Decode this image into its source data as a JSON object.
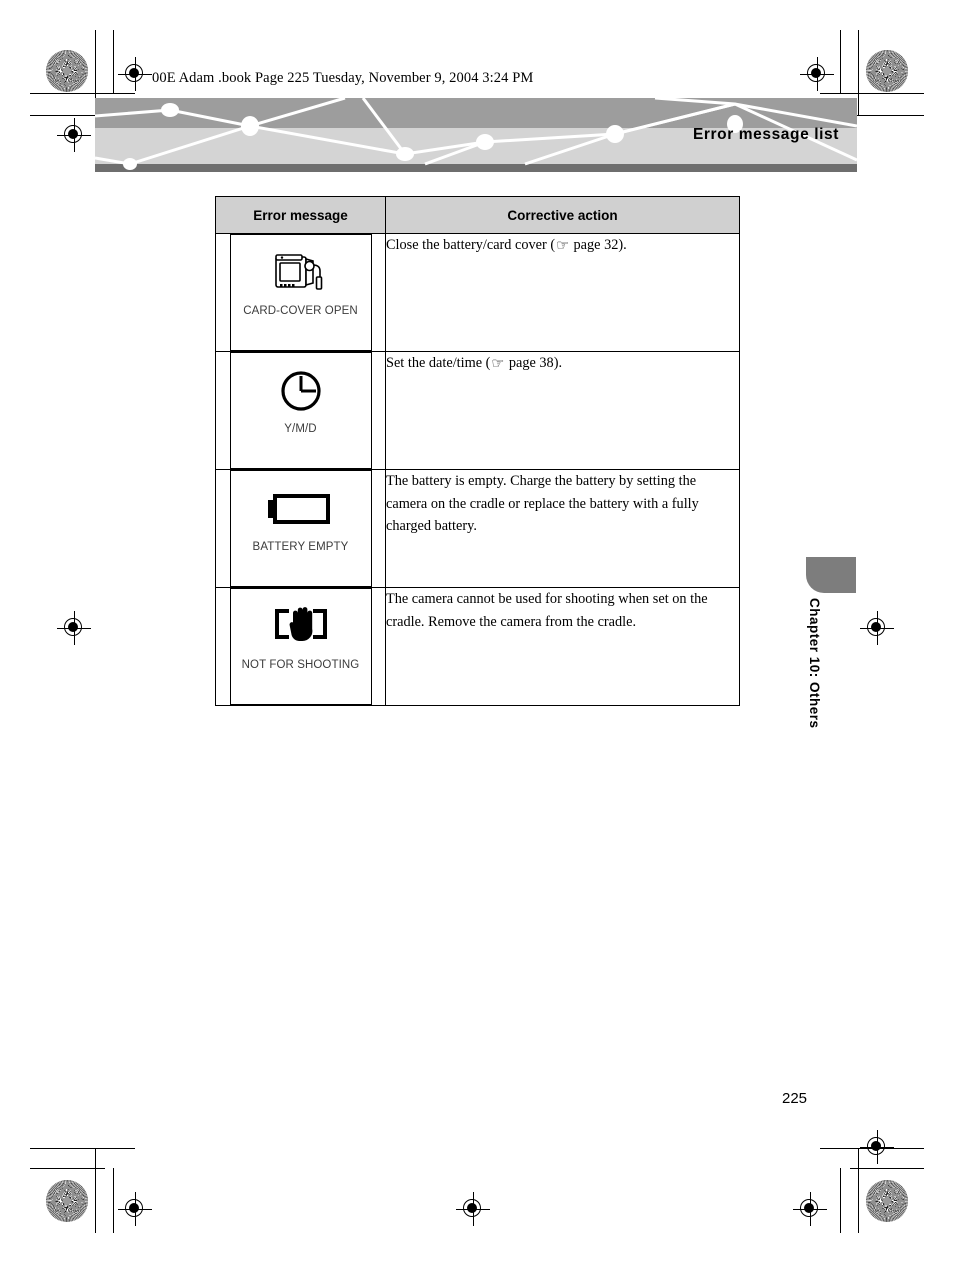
{
  "document": {
    "file_header": "00E Adam .book  Page 225  Tuesday, November 9, 2004  3:24 PM",
    "page_number": "225",
    "chapter_label": "Chapter 10: Others",
    "banner_title": "Error message list"
  },
  "table": {
    "headers": {
      "error_message": "Error message",
      "corrective_action": "Corrective action"
    },
    "rows": [
      {
        "icon_name": "camera-card-cover-open-icon",
        "icon_caption": "CARD-COVER OPEN",
        "action_text": "Close the battery/card cover  (",
        "action_ref": "page 32",
        "action_tail": ")."
      },
      {
        "icon_name": "clock-icon",
        "icon_caption": "Y/M/D",
        "action_text": "Set the date/time  (",
        "action_ref": "page 38",
        "action_tail": ")."
      },
      {
        "icon_name": "battery-empty-icon",
        "icon_caption": "BATTERY EMPTY",
        "action_text": "The battery is empty. Charge the battery by setting the camera on the cradle or replace the battery with a fully charged battery.",
        "action_ref": "",
        "action_tail": ""
      },
      {
        "icon_name": "hand-stop-not-for-shooting-icon",
        "icon_caption": "NOT FOR SHOOTING",
        "action_text": "The camera cannot be used for shooting when set on the cradle. Remove the camera from the cradle.",
        "action_ref": "",
        "action_tail": ""
      }
    ]
  },
  "colors": {
    "header_fill": "#d0d0d0",
    "banner_dark": "#9d9d9d",
    "banner_light": "#d4d4d4",
    "banner_base": "#6e6e6e",
    "tab_gray": "#7d7d7d"
  }
}
